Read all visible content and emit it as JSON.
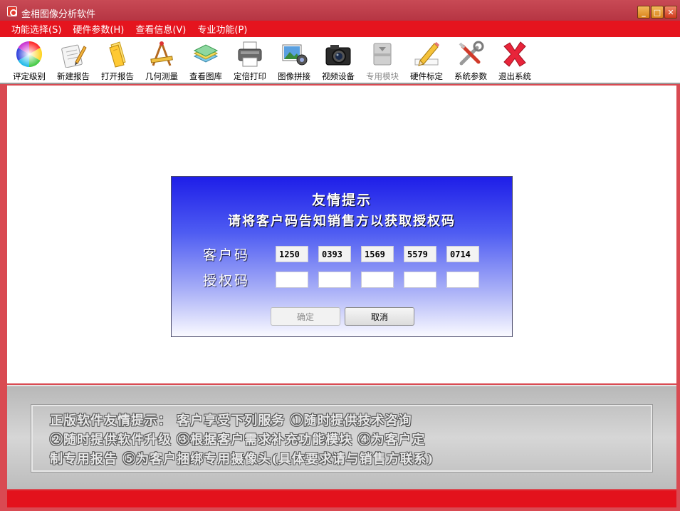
{
  "window": {
    "title": "金相图像分析软件"
  },
  "menu": [
    {
      "label": "功能选择(S)"
    },
    {
      "label": "硬件参数(H)"
    },
    {
      "label": "查看信息(V)"
    },
    {
      "label": "专业功能(P)"
    }
  ],
  "toolbar": [
    {
      "label": "评定级别",
      "icon": "color-wheel-icon"
    },
    {
      "label": "新建报告",
      "icon": "new-report-icon"
    },
    {
      "label": "打开报告",
      "icon": "open-folder-icon"
    },
    {
      "label": "几何测量",
      "icon": "measure-tool-icon"
    },
    {
      "label": "查看图库",
      "icon": "gallery-icon"
    },
    {
      "label": "定倍打印",
      "icon": "printer-icon"
    },
    {
      "label": "图像拼接",
      "icon": "image-stitch-icon"
    },
    {
      "label": "视频设备",
      "icon": "camera-icon"
    },
    {
      "label": "专用模块",
      "icon": "module-icon",
      "disabled": true
    },
    {
      "label": "硬件标定",
      "icon": "pencil-icon"
    },
    {
      "label": "系统参数",
      "icon": "tools-icon"
    },
    {
      "label": "退出系统",
      "icon": "exit-icon"
    }
  ],
  "dialog": {
    "title": "友情提示",
    "subtitle": "请将客户码告知销售方以获取授权码",
    "customer_code_label": "客户码",
    "auth_code_label": "授权码",
    "customer_code": [
      "1250",
      "0393",
      "1569",
      "5579",
      "0714"
    ],
    "auth_code": [
      "",
      "",
      "",
      "",
      ""
    ],
    "ok_label": "确定",
    "cancel_label": "取消"
  },
  "banner": {
    "line1": "正版软件友情提示：   客户享受下列服务  ①随时提供技术咨询",
    "line2": "②随时提供软件升级 ③根据客户需求补充功能模块 ④为客户定",
    "line3": "制专用报告 ⑤为客户捆绑专用摄像头(具体要求请与销售方联系)"
  },
  "colors": {
    "menu_bg": "#e5141e",
    "dialog_top": "#1e1ee8",
    "dialog_bottom": "#fafaff",
    "status_red": "#e3121c"
  }
}
